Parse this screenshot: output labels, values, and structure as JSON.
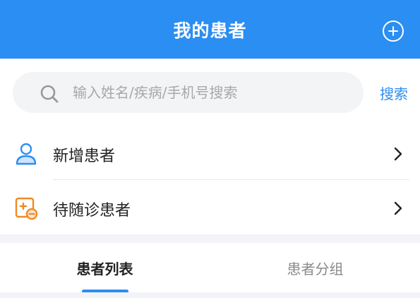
{
  "header": {
    "title": "我的患者",
    "add_icon": "plus-circle-icon"
  },
  "search": {
    "placeholder": "输入姓名/疾病/手机号搜索",
    "value": "",
    "button_label": "搜索",
    "icon": "search-icon"
  },
  "menu": {
    "items": [
      {
        "label": "新增患者",
        "icon": "user-icon"
      },
      {
        "label": "待随诊患者",
        "icon": "followup-icon"
      }
    ]
  },
  "tabs": [
    {
      "label": "患者列表",
      "active": true
    },
    {
      "label": "患者分组",
      "active": false
    }
  ],
  "colors": {
    "primary": "#2b8ef2",
    "accent_orange": "#f08a24",
    "background_gray": "#f2f4f7"
  }
}
